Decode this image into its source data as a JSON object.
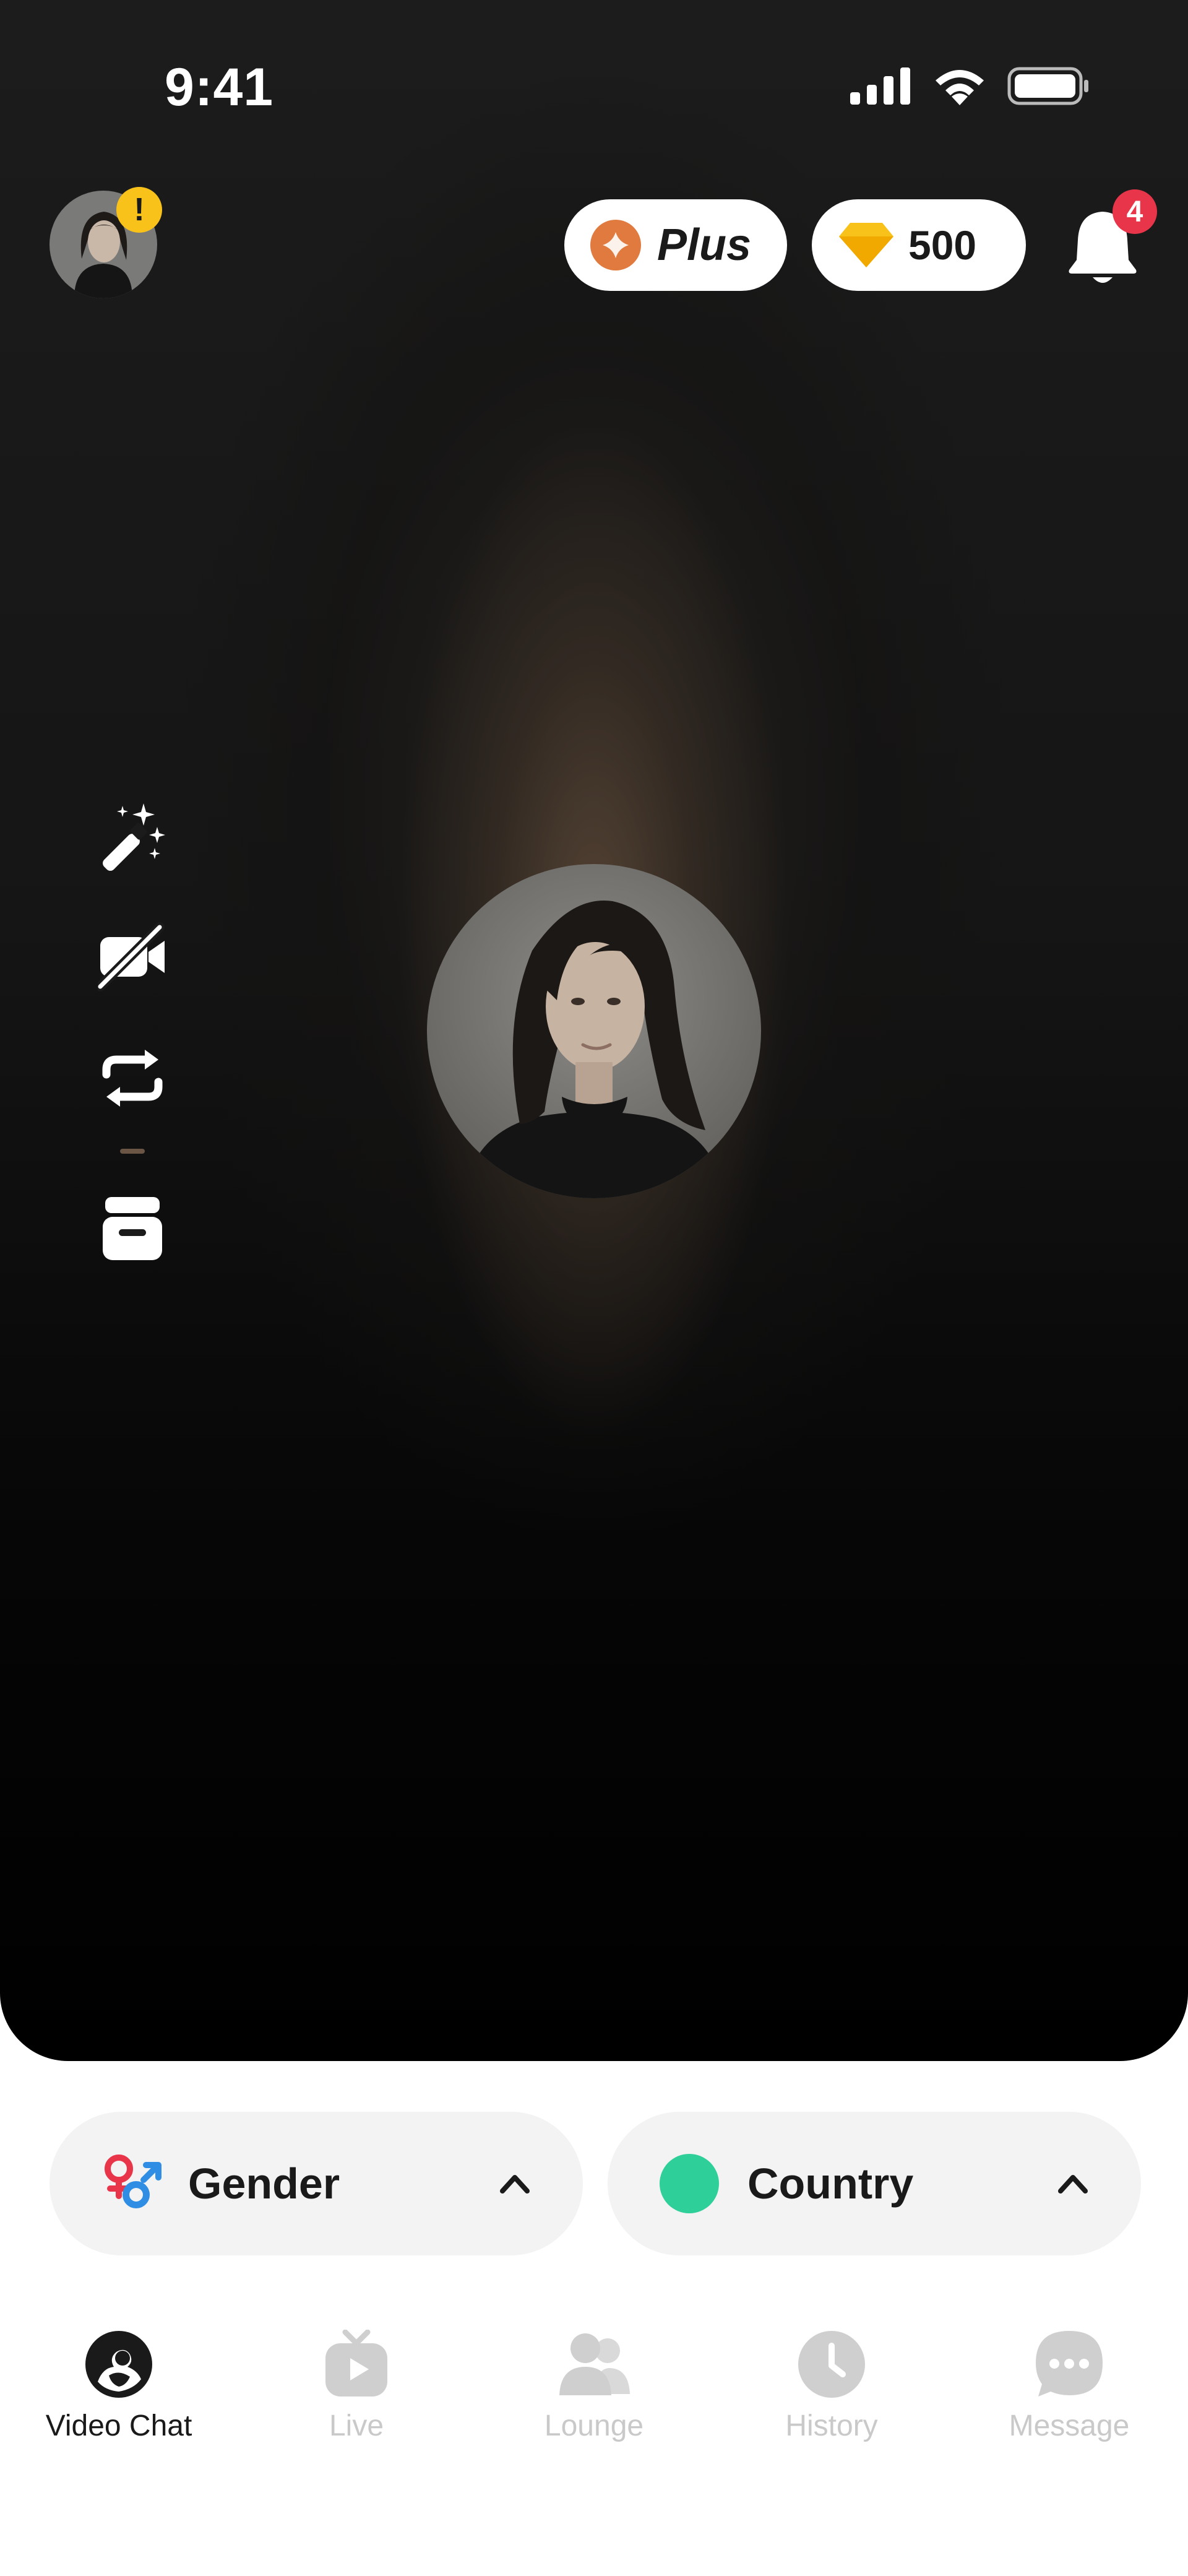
{
  "status_bar": {
    "time": "9:41",
    "icons": [
      "cellular-signal-icon",
      "wifi-icon",
      "battery-icon"
    ]
  },
  "header": {
    "profile_badge": "!",
    "plus_label": "Plus",
    "gems_count": "500",
    "notification_count": "4"
  },
  "side_controls": [
    {
      "name": "magic-wand-icon"
    },
    {
      "name": "camera-off-icon"
    },
    {
      "name": "switch-camera-icon"
    },
    {
      "name": "inbox-icon"
    }
  ],
  "filters": {
    "gender": {
      "label": "Gender"
    },
    "country": {
      "label": "Country"
    }
  },
  "nav": {
    "items": [
      {
        "label": "Video Chat",
        "active": true
      },
      {
        "label": "Live",
        "active": false
      },
      {
        "label": "Lounge",
        "active": false
      },
      {
        "label": "History",
        "active": false
      },
      {
        "label": "Message",
        "active": false
      }
    ]
  },
  "colors": {
    "plus_accent": "#e07a3e",
    "gem_accent": "#f8c21a",
    "warning_badge": "#f8c21a",
    "notification_badge": "#e8354a",
    "country_dot": "#2fcf9a",
    "gender_female": "#e8354a",
    "gender_male": "#2f8de4",
    "nav_active": "#1a1a1a",
    "nav_inactive": "#c9c9c9"
  }
}
